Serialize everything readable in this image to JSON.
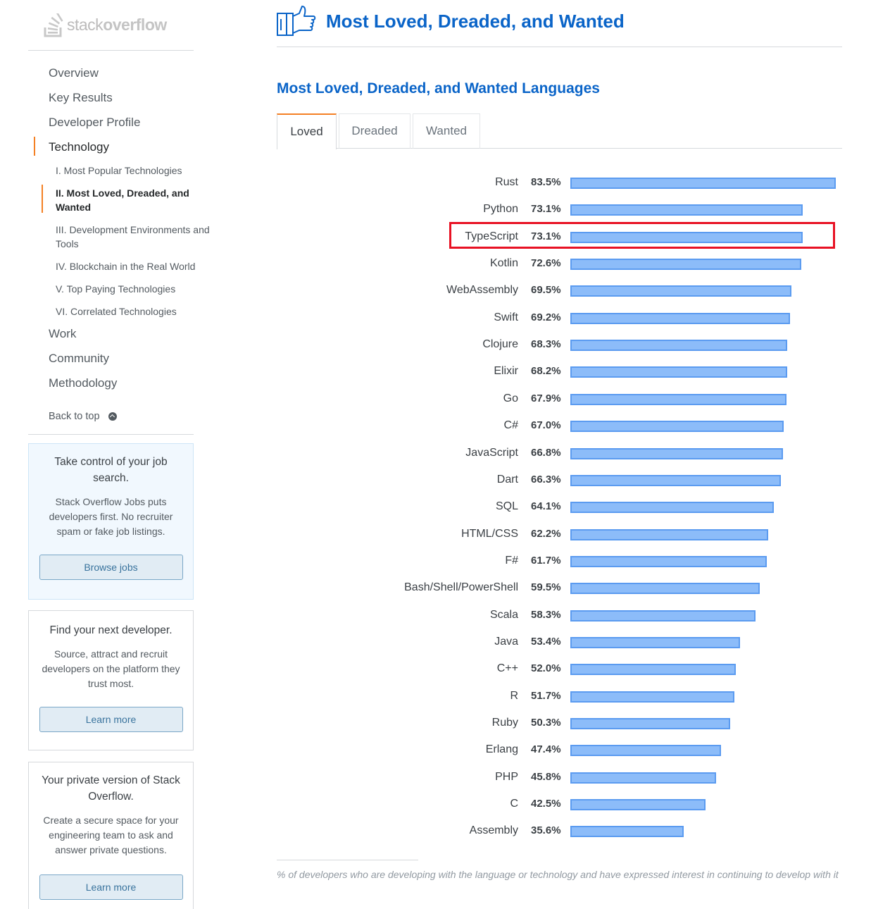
{
  "brand": {
    "logo_light": "stack",
    "logo_bold": "overflow"
  },
  "sidebar": {
    "nav": [
      {
        "label": "Overview",
        "active": false
      },
      {
        "label": "Key Results",
        "active": false
      },
      {
        "label": "Developer Profile",
        "active": false
      },
      {
        "label": "Technology",
        "active": true
      }
    ],
    "subnav": [
      {
        "label": "I. Most Popular Technologies",
        "active": false
      },
      {
        "label": "II. Most Loved, Dreaded, and Wanted",
        "active": true
      },
      {
        "label": "III. Development Environments and Tools",
        "active": false
      },
      {
        "label": "IV. Blockchain in the Real World",
        "active": false
      },
      {
        "label": "V. Top Paying Technologies",
        "active": false
      },
      {
        "label": "VI. Correlated Technologies",
        "active": false
      }
    ],
    "nav_after": [
      {
        "label": "Work"
      },
      {
        "label": "Community"
      },
      {
        "label": "Methodology"
      }
    ],
    "back_to_top": "Back to top",
    "promos": {
      "jobs": {
        "title": "Take control of your job search.",
        "text": "Stack Overflow Jobs puts developers first. No recruiter spam or fake job listings.",
        "button": "Browse jobs"
      },
      "dev": {
        "title": "Find your next developer.",
        "text": "Source, attract and recruit developers on the platform they trust most.",
        "button": "Learn more"
      },
      "teams": {
        "title": "Your private version of Stack Overflow.",
        "text": "Create a secure space for your engineering team to ask and answer private questions.",
        "button": "Learn more"
      }
    }
  },
  "main": {
    "page_title": "Most Loved, Dreaded, and Wanted",
    "section_title": "Most Loved, Dreaded, and Wanted Languages",
    "tabs": [
      {
        "label": "Loved",
        "active": true
      },
      {
        "label": "Dreaded",
        "active": false
      },
      {
        "label": "Wanted",
        "active": false
      }
    ],
    "highlighted_language": "TypeScript",
    "footnote": "% of developers who are developing with the language or technology and have expressed interest in continuing to develop with it"
  },
  "colors": {
    "accent_orange": "#f48024",
    "title_blue": "#0a64c8",
    "bar_fill": "#8cbcf9",
    "bar_border": "#5b9bf0",
    "highlight_red": "#e81123"
  },
  "chart_data": {
    "type": "bar",
    "orientation": "horizontal",
    "categories": [
      "Rust",
      "Python",
      "TypeScript",
      "Kotlin",
      "WebAssembly",
      "Swift",
      "Clojure",
      "Elixir",
      "Go",
      "C#",
      "JavaScript",
      "Dart",
      "SQL",
      "HTML/CSS",
      "F#",
      "Bash/Shell/PowerShell",
      "Scala",
      "Java",
      "C++",
      "R",
      "Ruby",
      "Erlang",
      "PHP",
      "C",
      "Assembly"
    ],
    "values": [
      83.5,
      73.1,
      73.1,
      72.6,
      69.5,
      69.2,
      68.3,
      68.2,
      67.9,
      67.0,
      66.8,
      66.3,
      64.1,
      62.2,
      61.7,
      59.5,
      58.3,
      53.4,
      52.0,
      51.7,
      50.3,
      47.4,
      45.8,
      42.5,
      35.6
    ],
    "value_labels": [
      "83.5%",
      "73.1%",
      "73.1%",
      "72.6%",
      "69.5%",
      "69.2%",
      "68.3%",
      "68.2%",
      "67.9%",
      "67.0%",
      "66.8%",
      "66.3%",
      "64.1%",
      "62.2%",
      "61.7%",
      "59.5%",
      "58.3%",
      "53.4%",
      "52.0%",
      "51.7%",
      "50.3%",
      "47.4%",
      "45.8%",
      "42.5%",
      "35.6%"
    ],
    "xlim": [
      0,
      83.5
    ],
    "grid": false,
    "legend": "none"
  }
}
